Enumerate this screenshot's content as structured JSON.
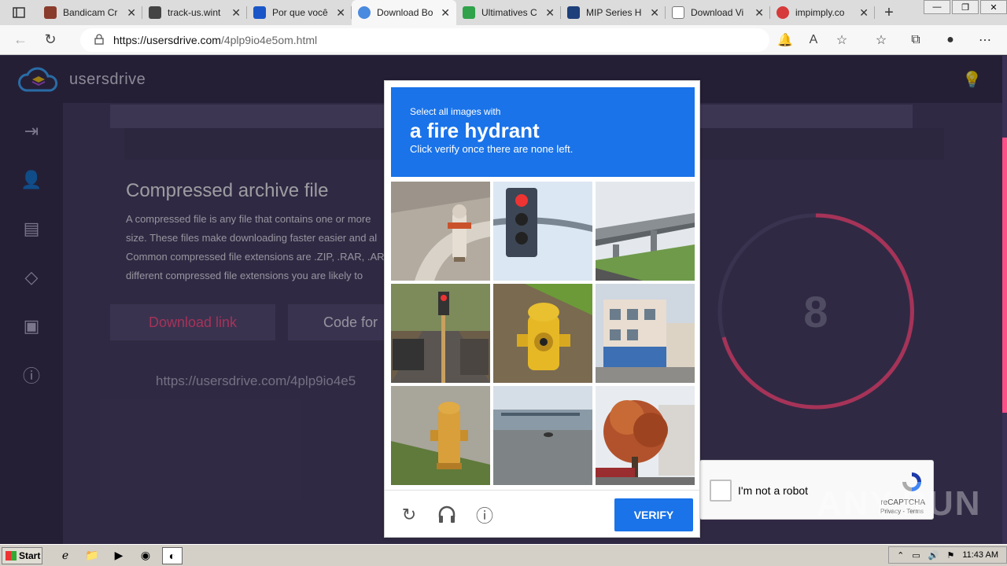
{
  "browser": {
    "tabs": [
      {
        "label": "Bandicam Cr",
        "favicon_color": "#8a3c2c"
      },
      {
        "label": "track-us.wint",
        "favicon_color": "#444444"
      },
      {
        "label": "Por que você",
        "favicon_color": "#1a56c8"
      },
      {
        "label": "Download Bo",
        "favicon_color": "#4a8adf",
        "active": true
      },
      {
        "label": "Ultimatives C",
        "favicon_color": "#2fa24a"
      },
      {
        "label": "MIP Series H",
        "favicon_color": "#1d3f7a"
      },
      {
        "label": "Download Vi",
        "favicon_color": "#777777"
      },
      {
        "label": "impimply.co",
        "favicon_color": "#d73a3a"
      }
    ],
    "new_tab": "+",
    "url_host": "https://usersdrive.com",
    "url_path": "/4plp9io4e5om.html"
  },
  "site": {
    "name": "usersdrive",
    "section_title": "Compressed archive file",
    "section_text": [
      "A compressed file is any file that contains one or more",
      "size. These files make downloading faster easier and al",
      "Common compressed file extensions are .ZIP, .RAR, .AR",
      "different compressed file extensions you are likely to"
    ],
    "download_button": "Download link",
    "code_button": "Code for",
    "download_url": "https://usersdrive.com/4plp9io4e5",
    "countdown_value": "8",
    "accent_color": "#ff4f88"
  },
  "recaptcha": {
    "anchor_label": "I'm not a robot",
    "brand": "reCAPTCHA",
    "terms": "Privacy - Terms",
    "challenge_small": "Select all images with",
    "challenge_object": "a fire hydrant",
    "challenge_sub": "Click verify once there are none left.",
    "verify_label": "VERIFY",
    "tiles": [
      "hydrant-sidewalk",
      "traffic-light",
      "highway-overpass",
      "street-traffic-light",
      "yellow-hydrant",
      "building",
      "yellow-hydrant-grass",
      "parking-lot",
      "tree-house"
    ]
  },
  "watermark": "ANY.RUN",
  "taskbar": {
    "start": "Start",
    "clock": "11:43 AM"
  }
}
